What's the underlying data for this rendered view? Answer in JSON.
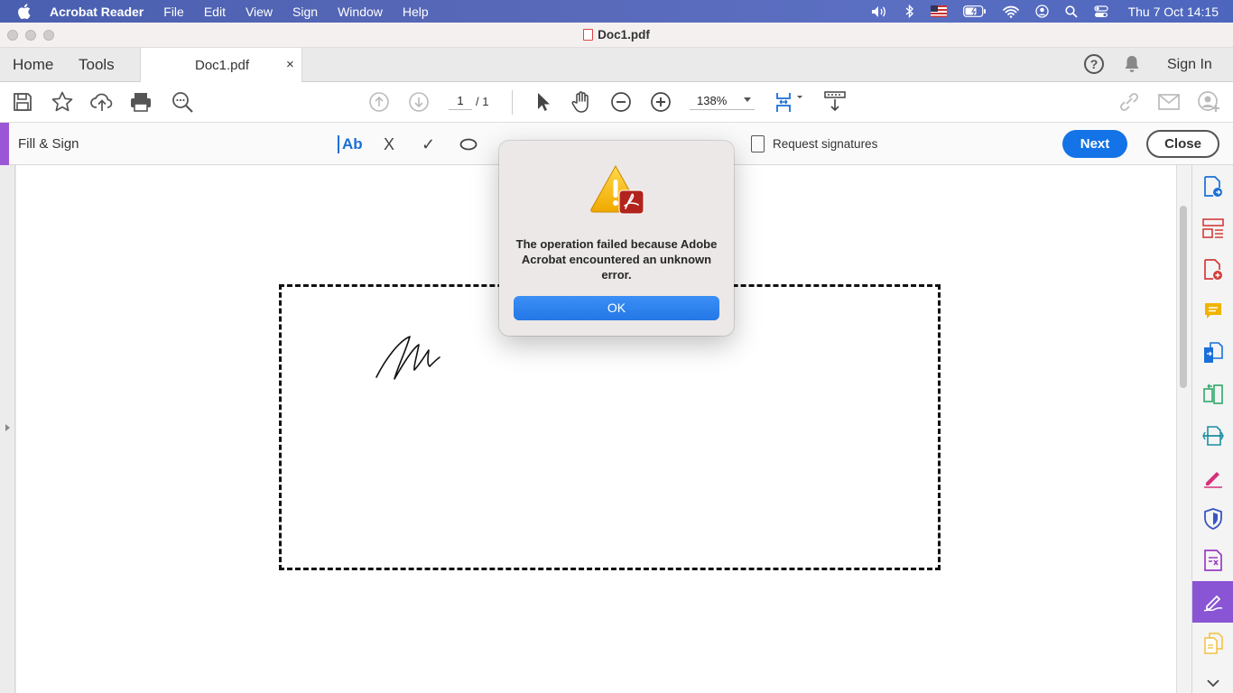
{
  "menubar": {
    "app": "Acrobat Reader",
    "items": [
      "File",
      "Edit",
      "View",
      "Sign",
      "Window",
      "Help"
    ],
    "clock": "Thu 7 Oct  14:15"
  },
  "window": {
    "title": "Doc1.pdf"
  },
  "tabs": {
    "home": "Home",
    "tools": "Tools",
    "doc": "Doc1.pdf",
    "doc_close": "×",
    "sign_in": "Sign In",
    "help": "?"
  },
  "toolbar": {
    "page_current": "1",
    "page_total": "/  1",
    "zoom": "138%"
  },
  "fill_sign": {
    "label": "Fill & Sign",
    "text_tool": "Ab",
    "cross": "X",
    "check": "✓",
    "request": "Request signatures",
    "next": "Next",
    "close": "Close"
  },
  "dialog": {
    "message": "The operation failed because Adobe Acrobat encountered an unknown error.",
    "ok": "OK"
  }
}
